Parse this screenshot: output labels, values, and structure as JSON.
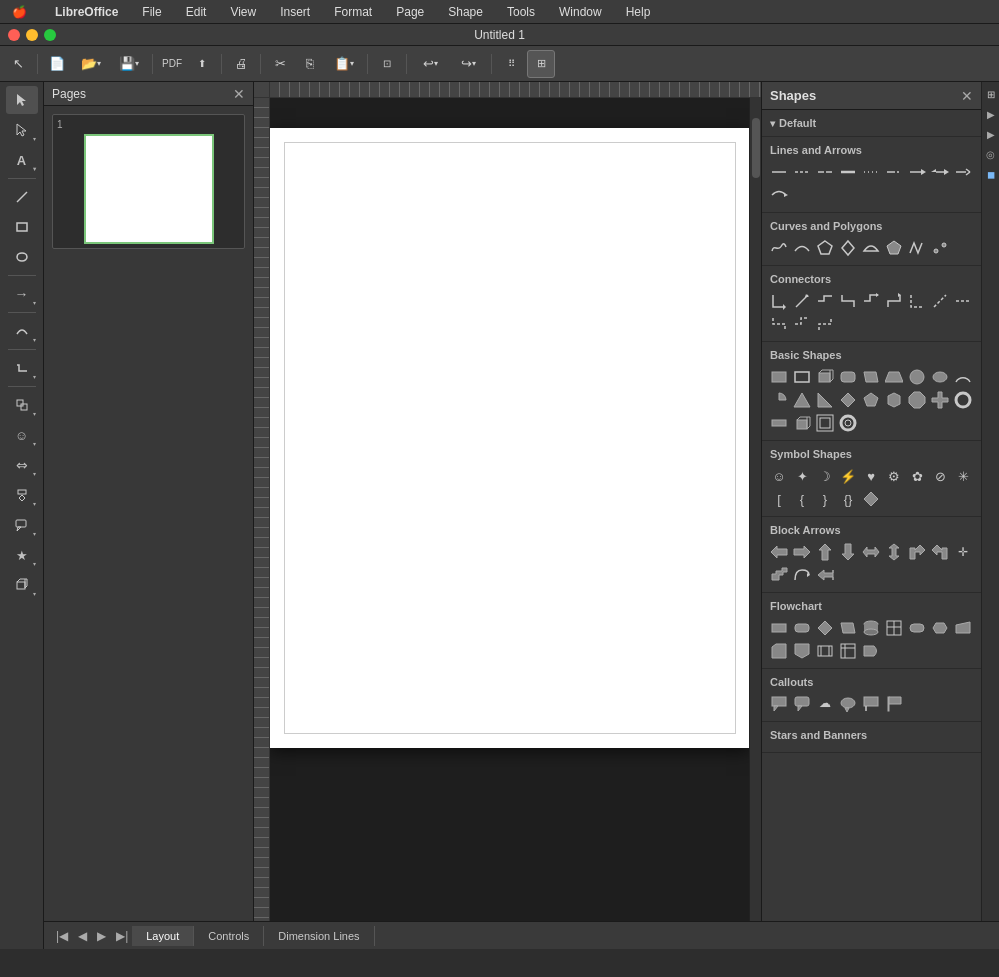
{
  "app": {
    "title": "Untitled 1",
    "name": "LibreOffice"
  },
  "menubar": {
    "apple": "🍎",
    "items": [
      "LibreOffice",
      "File",
      "Edit",
      "View",
      "Insert",
      "Format",
      "Page",
      "Shape",
      "Tools",
      "Window",
      "Help"
    ]
  },
  "toolbar": {
    "buttons": [
      "cursor",
      "new",
      "open",
      "save",
      "export-pdf",
      "export",
      "print",
      "cut",
      "copy",
      "paste",
      "clone",
      "undo",
      "redo",
      "grid-snap",
      "grid-display"
    ]
  },
  "pages_panel": {
    "title": "Pages",
    "page_number": "1"
  },
  "shapes_panel": {
    "title": "Shapes",
    "sections": [
      {
        "id": "default",
        "label": "Default",
        "expanded": true,
        "subsections": [
          {
            "label": "Lines and Arrows",
            "shapes": [
              "—",
              "—",
              "—",
              "—",
              "—",
              "—",
              "↩",
              "↩",
              "⇌",
              "↗",
              "→",
              "⟵"
            ]
          },
          {
            "label": "Curves and Polygons",
            "shapes": [
              "✏",
              "~",
              "△",
              "⬡",
              "⬟",
              "▪",
              "◀",
              "▷"
            ]
          },
          {
            "label": "Connectors",
            "shapes": [
              "⌐",
              "↗",
              "⌐",
              "⌐",
              "⌐",
              "↗",
              "⌐",
              "⌐",
              "⌐",
              "⌐",
              "⌐",
              "↗"
            ]
          },
          {
            "label": "Basic Shapes",
            "shapes": [
              "▪",
              "▪",
              "▪",
              "▪",
              "▱",
              "▼",
              "●",
              "○",
              "◯",
              "◜",
              "▲",
              "△",
              "◆",
              "⬠",
              "●",
              "●",
              "+",
              "●",
              "▪",
              "▪",
              "▪",
              "○"
            ]
          },
          {
            "label": "Symbol Shapes",
            "shapes": [
              "☺",
              "✦",
              "☽",
              "⚡",
              "♥",
              "⚙",
              "☉",
              "⊘",
              "✳",
              "[]",
              "{}",
              "{}",
              "{}",
              "◆"
            ]
          },
          {
            "label": "Block Arrows",
            "shapes": [
              "←",
              "→",
              "↑",
              "↓",
              "↔",
              "↕",
              "⌐",
              "⌐",
              "+",
              "⌐",
              "⌐",
              "→",
              "→",
              "⌐",
              "⌐",
              "⌐",
              "+",
              "⌐",
              "⌐",
              "⌐",
              "⌐",
              "⌐"
            ]
          },
          {
            "label": "Flowchart",
            "shapes": [
              "▪",
              "▪",
              "◆",
              "▱",
              "▮",
              "▦",
              "▪",
              "▪",
              "●",
              "▪",
              "▲",
              "▼",
              "◑",
              "◐"
            ]
          },
          {
            "label": "Callouts",
            "shapes": [
              "▪",
              "▪",
              "▪",
              "▪",
              "▪",
              "▪"
            ]
          },
          {
            "label": "Stars and Banners",
            "shapes": []
          }
        ]
      }
    ]
  },
  "statusbar": {
    "tabs": [
      "Layout",
      "Controls",
      "Dimension Lines"
    ],
    "active_tab": "Layout"
  }
}
